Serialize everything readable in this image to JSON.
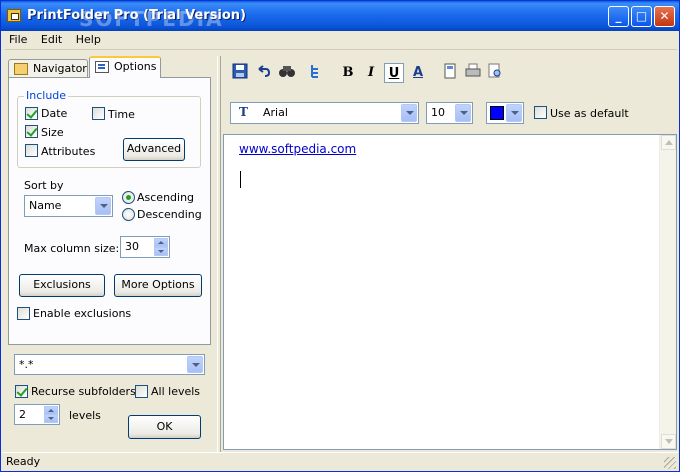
{
  "window": {
    "title": "PrintFolder Pro (Trial Version)",
    "watermark": "SOFTPEDIA",
    "controls": {
      "minimize": "_",
      "maximize": "□",
      "close": "✕"
    }
  },
  "menu": {
    "items": [
      "File",
      "Edit",
      "Help"
    ]
  },
  "left_tabs": [
    {
      "label": "Navigator",
      "icon": "folder-icon",
      "active": false
    },
    {
      "label": "Options",
      "icon": "options-icon",
      "active": true
    }
  ],
  "include": {
    "legend": "Include",
    "date": {
      "label": "Date",
      "checked": true
    },
    "time": {
      "label": "Time",
      "checked": false
    },
    "size": {
      "label": "Size",
      "checked": true
    },
    "attributes": {
      "label": "Attributes",
      "checked": false
    },
    "advanced_button": "Advanced"
  },
  "sort": {
    "label": "Sort by",
    "selected": "Name",
    "ascending": "Ascending",
    "descending": "Descending",
    "order": "Ascending"
  },
  "max_column": {
    "label": "Max column size:",
    "value": "30"
  },
  "buttons": {
    "exclusions": "Exclusions",
    "more_options": "More Options",
    "ok": "OK"
  },
  "enable_exclusions": {
    "label": "Enable exclusions",
    "checked": false
  },
  "filter": {
    "value": "*.*"
  },
  "recurse": {
    "label": "Recurse subfolders:",
    "checked": true
  },
  "all_levels": {
    "label": "All levels",
    "checked": false
  },
  "levels": {
    "value": "2",
    "label": "levels"
  },
  "toolbar": {
    "icons": [
      "save-icon",
      "undo-icon",
      "find-icon",
      "tree-icon",
      "bold-icon",
      "italic-icon",
      "underline-icon",
      "font-style-icon",
      "page-icon",
      "print-icon",
      "preview-icon"
    ],
    "bold": "B",
    "italic": "I",
    "underline": "U",
    "font_style": "A"
  },
  "fontbar": {
    "font_name": "Arial",
    "font_size": "10",
    "color": "#0000ff",
    "use_default": {
      "label": "Use as default",
      "checked": false
    }
  },
  "editor": {
    "link": "www.softpedia.com"
  },
  "status": {
    "text": "Ready"
  }
}
